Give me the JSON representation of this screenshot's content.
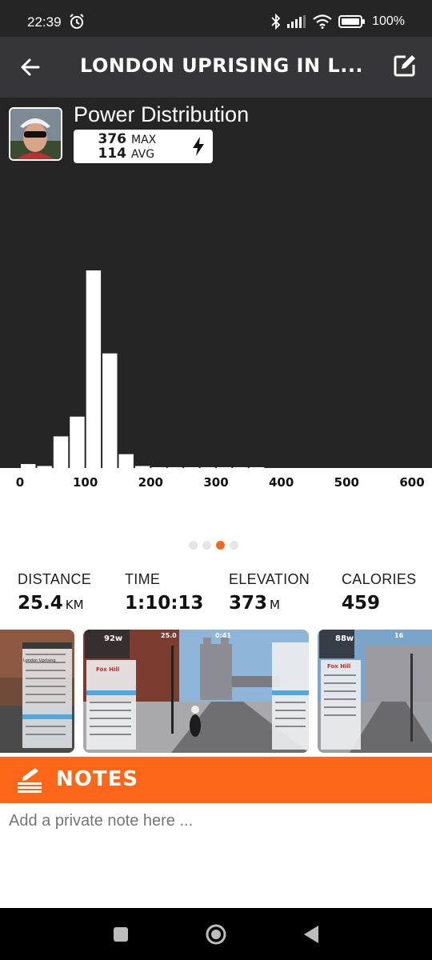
{
  "status_bar": {
    "time": "22:39",
    "battery": "100%",
    "icons": [
      "alarm-icon",
      "bluetooth-icon",
      "signal-icon",
      "wifi-icon",
      "battery-icon"
    ]
  },
  "header": {
    "title": "LONDON UPRISING IN L...",
    "back_icon": "arrow-left-icon",
    "edit_icon": "edit-icon"
  },
  "power": {
    "title": "Power Distribution",
    "max_value": "376",
    "max_label": "MAX",
    "avg_value": "114",
    "avg_label": "AVG"
  },
  "chart_data": {
    "type": "bar",
    "title": "Power Distribution",
    "xlabel": "",
    "ylabel": "",
    "x_ticks": [
      "0",
      "100",
      "200",
      "300",
      "400",
      "500",
      "600"
    ],
    "xlim": [
      0,
      600
    ],
    "bin_width": 25,
    "bins": [
      0,
      25,
      50,
      75,
      100,
      125,
      150,
      175,
      200,
      225,
      250,
      275,
      300,
      325,
      350
    ],
    "values": [
      2,
      1,
      16,
      26,
      100,
      58,
      7,
      1,
      0.3,
      0.3,
      0.3,
      0.3,
      0.3,
      0.3,
      0.3
    ],
    "ylim": [
      0,
      100
    ],
    "grid": false,
    "colors": {
      "bar": "#ffffff",
      "background": "#262526"
    }
  },
  "pager": {
    "count": 4,
    "active": 2
  },
  "stats": [
    {
      "label": "DISTANCE",
      "value": "25.4",
      "unit": "KM"
    },
    {
      "label": "TIME",
      "value": "1:10:13",
      "unit": ""
    },
    {
      "label": "ELEVATION",
      "value": "373",
      "unit": "M"
    },
    {
      "label": "CALORIES",
      "value": "459",
      "unit": ""
    }
  ],
  "screenshots": [
    {
      "label": "London Uprising"
    },
    {
      "label": "Fox Hill",
      "hud_power": "92w",
      "hud_dist": "25.0",
      "hud_time": "0:41"
    },
    {
      "label": "Fox Hill",
      "hud_power": "88w",
      "hud_dist": "16"
    }
  ],
  "notes": {
    "heading": "NOTES",
    "placeholder": "Add a private note here ..."
  },
  "nav_bar": {
    "icons": [
      "recents-icon",
      "home-icon",
      "back-icon"
    ]
  },
  "colors": {
    "accent": "#fc6719",
    "dark_panel": "#262526",
    "header": "#363537"
  }
}
